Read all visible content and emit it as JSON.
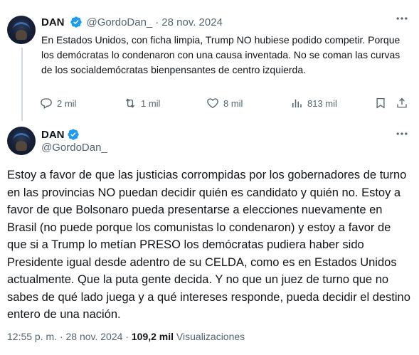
{
  "reply": {
    "author_name": "DAN",
    "handle": "@GordoDan_",
    "separator": "·",
    "date": "28 nov. 2024",
    "text": "En Estados Unidos, con ficha limpia, Trump NO hubiese podido competir. Porque los demócratas lo condenaron con una causa inventada. No se coman las curvas de los socialdemócratas bienpensantes de centro izquierda.",
    "replies": "2 mil",
    "reposts": "1 mil",
    "likes": "8 mil",
    "views": "813 mil"
  },
  "main": {
    "author_name": "DAN",
    "handle": "@GordoDan_",
    "text": "Estoy a favor de que las justicias corrompidas por los gobernadores de turno en las provincias NO puedan decidir quién es candidato y quién no. Estoy a favor de que Bolsonaro pueda presentarse a elecciones nuevamente en Brasil (no puede porque los comunistas lo condenaron) y estoy a favor de que si a Trump lo metían PRESO los demócratas pudiera haber sido Presidente igual desde adentro de su CELDA, como es en Estados Unidos actualmente. Que la puta gente decida. Y no que un juez de turno que no sabes de qué lado juega y a qué intereses responde, pueda decidir el destino entero de una nación.",
    "time": "12:55 p. m.",
    "separator": "·",
    "date": "28 nov. 2024",
    "separator2": "·",
    "views_count": "109,2 mil",
    "views_label": "Visualizaciones"
  },
  "colors": {
    "verified": "#1d9bf0",
    "muted": "#536471",
    "text": "#0f1419",
    "thread_line": "#cfd9de"
  },
  "icons": {
    "verified": "verified-badge-icon",
    "more": "more-icon",
    "reply": "reply-icon",
    "repost": "repost-icon",
    "like": "like-icon",
    "views": "views-icon",
    "bookmark": "bookmark-icon",
    "share": "share-icon"
  }
}
